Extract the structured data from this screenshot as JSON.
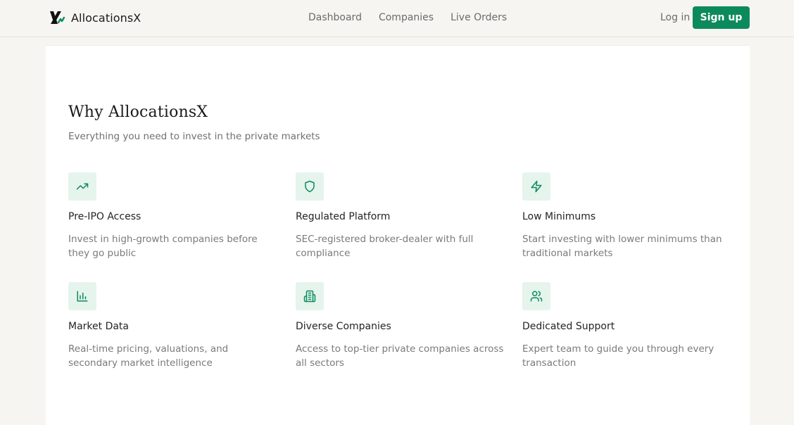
{
  "brand": {
    "name": "AllocationsX",
    "accent": "#0d8a5c"
  },
  "nav": {
    "items": [
      "Dashboard",
      "Companies",
      "Live Orders"
    ]
  },
  "auth": {
    "login_label": "Log in",
    "signup_label": "Sign up"
  },
  "section": {
    "title": "Why AllocationsX",
    "subtitle": "Everything you need to invest in the private markets"
  },
  "features": [
    {
      "icon": "trending-up-icon",
      "title": "Pre-IPO Access",
      "description": "Invest in high-growth companies before they go public"
    },
    {
      "icon": "shield-icon",
      "title": "Regulated Platform",
      "description": "SEC-registered broker-dealer with full compliance"
    },
    {
      "icon": "zap-icon",
      "title": "Low Minimums",
      "description": "Start investing with lower minimums than traditional markets"
    },
    {
      "icon": "bar-chart-icon",
      "title": "Market Data",
      "description": "Real-time pricing, valuations, and secondary market intelligence"
    },
    {
      "icon": "building-icon",
      "title": "Diverse Companies",
      "description": "Access to top-tier private companies across all sectors"
    },
    {
      "icon": "users-icon",
      "title": "Dedicated Support",
      "description": "Expert team to guide you through every transaction"
    }
  ],
  "colors": {
    "icon_bg": "#e5f4ec",
    "icon_stroke": "#0d8a5c",
    "page_bg": "#f6f5f1"
  }
}
